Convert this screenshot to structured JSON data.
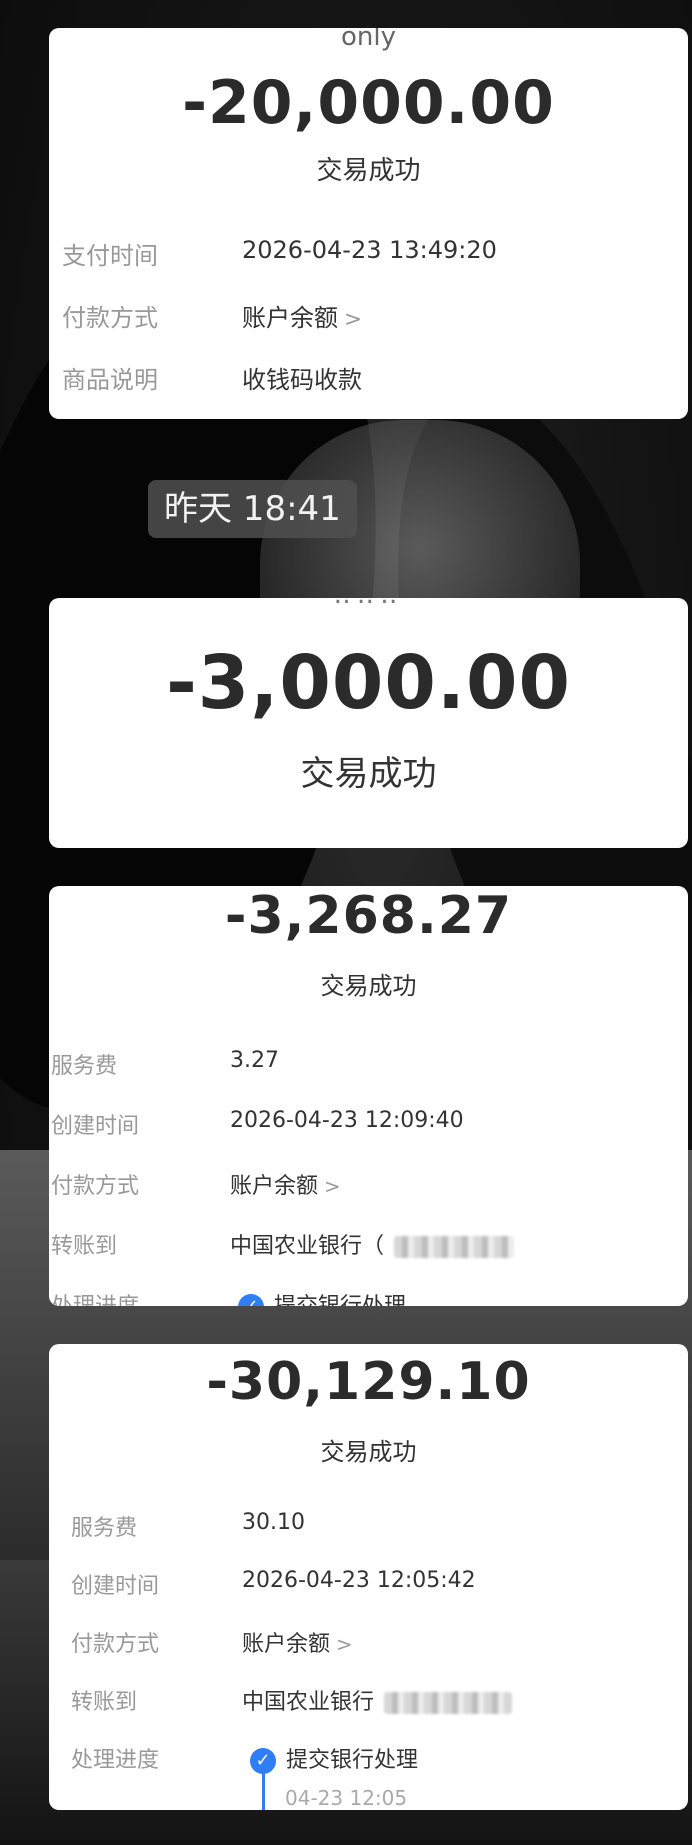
{
  "cards": [
    {
      "top_cut_text": "only",
      "amount": "-20,000.00",
      "status": "交易成功",
      "rows": [
        {
          "label": "支付时间",
          "value": "2026-04-23 13:49:20"
        },
        {
          "label": "付款方式",
          "value": "账户余额"
        },
        {
          "label": "商品说明",
          "value": "收钱码收款"
        }
      ]
    },
    {
      "amount": "-3,000.00",
      "status": "交易成功"
    },
    {
      "amount": "-3,268.27",
      "status": "交易成功",
      "rows": [
        {
          "label": "服务费",
          "value": "3.27"
        },
        {
          "label": "创建时间",
          "value": "2026-04-23 12:09:40"
        },
        {
          "label": "付款方式",
          "value": "账户余额"
        },
        {
          "label": "转账到",
          "value": "中国农业银行（"
        },
        {
          "label": "处理进度",
          "value": "提交银行处理"
        }
      ]
    },
    {
      "amount": "-30,129.10",
      "status": "交易成功",
      "rows": [
        {
          "label": "服务费",
          "value": "30.10"
        },
        {
          "label": "创建时间",
          "value": "2026-04-23 12:05:42"
        },
        {
          "label": "付款方式",
          "value": "账户余额"
        },
        {
          "label": "转账到",
          "value": "中国农业银行"
        },
        {
          "label": "处理进度",
          "value": "提交银行处理"
        }
      ],
      "progress_time": "04-23 12:05"
    }
  ],
  "timestamp": "昨天 18:41",
  "icons": {
    "chevron": "chevron-right-icon",
    "check": "check-circle-icon"
  },
  "colors": {
    "accent": "#2f7ef6",
    "card_bg": "#ffffff",
    "label": "#999999",
    "text": "#333333"
  }
}
